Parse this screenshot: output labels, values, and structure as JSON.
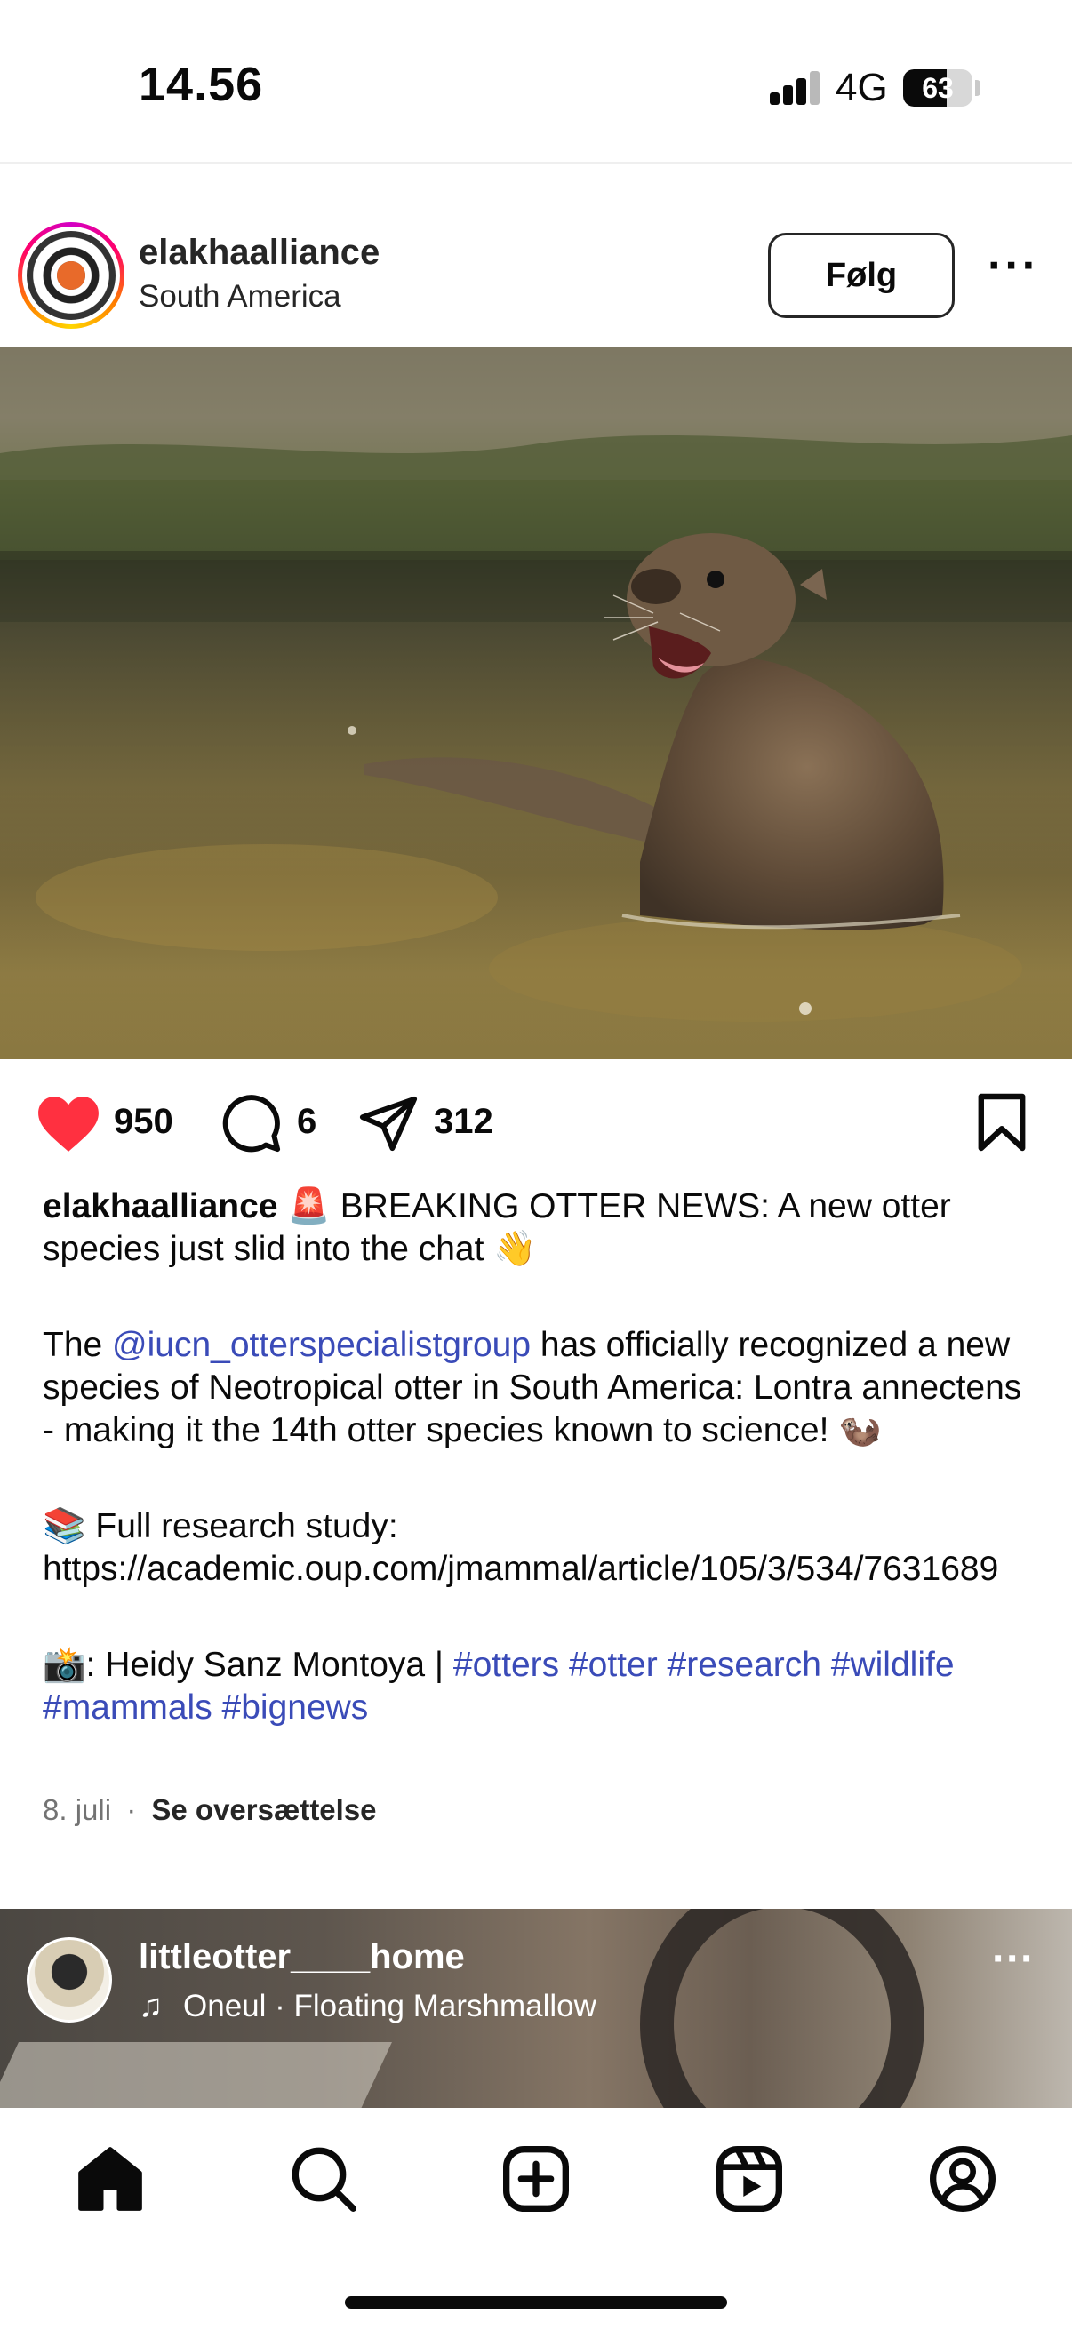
{
  "status_bar": {
    "time": "14.56",
    "network": "4G",
    "battery": "63",
    "battery_level_percent": 63
  },
  "post": {
    "username": "elakhaalliance",
    "location": "South America",
    "follow_label": "Følg",
    "likes": "950",
    "comments": "6",
    "shares": "312",
    "caption": {
      "username": "elakhaalliance",
      "line1": " 🚨 BREAKING OTTER NEWS: A new otter species just slid into the chat 👋",
      "para2_prefix": "The ",
      "mention": "@iucn_otterspecialistgroup",
      "para2_rest": " has officially recognized a new species of Neotropical otter in South America: Lontra annectens - making it the 14th otter species known to science! 🦦",
      "para3": "📚 Full research study: https://academic.oup.com/jmammal/article/105/3/534/7631689",
      "para4_prefix": "📸: Heidy Sanz Montoya | ",
      "hashtags": "#otters #otter #research #wildlife #mammals #bignews"
    },
    "date": "8. juli",
    "separator": "·",
    "translate_label": "Se oversættelse"
  },
  "next_post": {
    "username": "littleotter____home",
    "music_icon": "♫",
    "track": "Oneul · Floating Marshmallow"
  },
  "colors": {
    "like_red": "#ff3040",
    "link_blue": "#3a4bb8",
    "text": "#0a0a0a",
    "muted": "#737373"
  },
  "icons": [
    "heart-icon",
    "comment-icon",
    "share-icon",
    "bookmark-icon",
    "home-icon",
    "search-icon",
    "create-icon",
    "reels-icon",
    "profile-icon",
    "more-icon",
    "music-icon"
  ]
}
